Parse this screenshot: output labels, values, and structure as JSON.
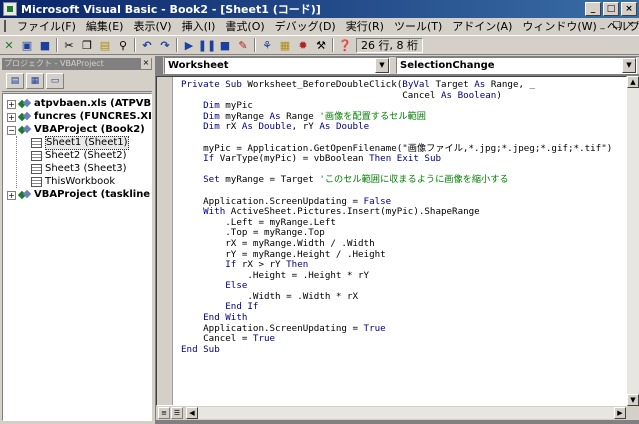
{
  "window": {
    "title": "Microsoft Visual Basic - Book2 - [Sheet1 (コード)]",
    "buttons": [
      "_",
      "□",
      "×"
    ]
  },
  "menu": {
    "items": [
      "ファイル(F)",
      "編集(E)",
      "表示(V)",
      "挿入(I)",
      "書式(O)",
      "デバッグ(D)",
      "実行(R)",
      "ツール(T)",
      "アドイン(A)",
      "ウィンドウ(W)",
      "ヘルプ(H)"
    ],
    "mdi_buttons": [
      "_",
      "□",
      "×"
    ]
  },
  "toolbar": {
    "status": "26 行, 8 桁"
  },
  "project": {
    "title": "プロジェクト - VBAProject",
    "close": "×",
    "nodes": [
      {
        "label": "atpvbaen.xls (ATPVBAEN",
        "expander": "+"
      },
      {
        "label": "funcres (FUNCRES.XLA)",
        "expander": "+"
      },
      {
        "label": "VBAProject (Book2)",
        "expander": "−"
      },
      {
        "label": "Sheet1 (Sheet1)"
      },
      {
        "label": "Sheet2 (Sheet2)"
      },
      {
        "label": "Sheet3 (Sheet3)"
      },
      {
        "label": "ThisWorkbook"
      },
      {
        "label": "VBAProject (taskline.xla)",
        "expander": "+"
      }
    ]
  },
  "code_window": {
    "object_combo": "Worksheet",
    "procedure_combo": "SelectionChange",
    "lines": [
      [
        [
          "kw",
          "Private Sub "
        ],
        [
          "",
          "Worksheet_BeforeDoubleClick("
        ],
        [
          "kw",
          "ByVal "
        ],
        [
          "",
          "Target "
        ],
        [
          "kw",
          "As "
        ],
        [
          "",
          "Range, _"
        ]
      ],
      [
        [
          "",
          "                                        Cancel "
        ],
        [
          "kw",
          "As Boolean"
        ],
        [
          "",
          ")"
        ]
      ],
      [
        [
          "kw",
          "    Dim "
        ],
        [
          "",
          "myPic"
        ]
      ],
      [
        [
          "kw",
          "    Dim "
        ],
        [
          "",
          "myRange "
        ],
        [
          "kw",
          "As "
        ],
        [
          "",
          "Range "
        ],
        [
          "cm",
          "'画像を配置するセル範囲"
        ]
      ],
      [
        [
          "kw",
          "    Dim "
        ],
        [
          "",
          "rX "
        ],
        [
          "kw",
          "As Double"
        ],
        [
          "",
          ", rY "
        ],
        [
          "kw",
          "As Double"
        ]
      ],
      [
        [
          "",
          ""
        ]
      ],
      [
        [
          "",
          "    myPic = Application.GetOpenFilename(\"画像ファイル,*.jpg;*.jpeg;*.gif;*.tif\")"
        ]
      ],
      [
        [
          "kw",
          "    If "
        ],
        [
          "",
          "VarType(myPic) = vbBoolean "
        ],
        [
          "kw",
          "Then Exit Sub"
        ]
      ],
      [
        [
          "",
          ""
        ]
      ],
      [
        [
          "kw",
          "    Set "
        ],
        [
          "",
          "myRange = Target "
        ],
        [
          "cm",
          "'このセル範囲に収まるように画像を縮小する"
        ]
      ],
      [
        [
          "",
          ""
        ]
      ],
      [
        [
          "",
          "    Application.ScreenUpdating = "
        ],
        [
          "kw",
          "False"
        ]
      ],
      [
        [
          "kw",
          "    With "
        ],
        [
          "",
          "ActiveSheet.Pictures.Insert(myPic).ShapeRange"
        ]
      ],
      [
        [
          "",
          "        .Left = myRange.Left"
        ]
      ],
      [
        [
          "",
          "        .Top = myRange.Top"
        ]
      ],
      [
        [
          "",
          "        rX = myRange.Width / .Width"
        ]
      ],
      [
        [
          "",
          "        rY = myRange.Height / .Height"
        ]
      ],
      [
        [
          "kw",
          "        If "
        ],
        [
          "",
          "rX > rY "
        ],
        [
          "kw",
          "Then"
        ]
      ],
      [
        [
          "",
          "            .Height = .Height * rY"
        ]
      ],
      [
        [
          "kw",
          "        Else"
        ]
      ],
      [
        [
          "",
          "            .Width = .Width * rX"
        ]
      ],
      [
        [
          "kw",
          "        End If"
        ]
      ],
      [
        [
          "kw",
          "    End With"
        ]
      ],
      [
        [
          "",
          "    Application.ScreenUpdating = "
        ],
        [
          "kw",
          "True"
        ]
      ],
      [
        [
          "",
          "    Cancel = "
        ],
        [
          "kw",
          "True"
        ]
      ],
      [
        [
          "kw",
          "End Sub"
        ]
      ]
    ]
  }
}
